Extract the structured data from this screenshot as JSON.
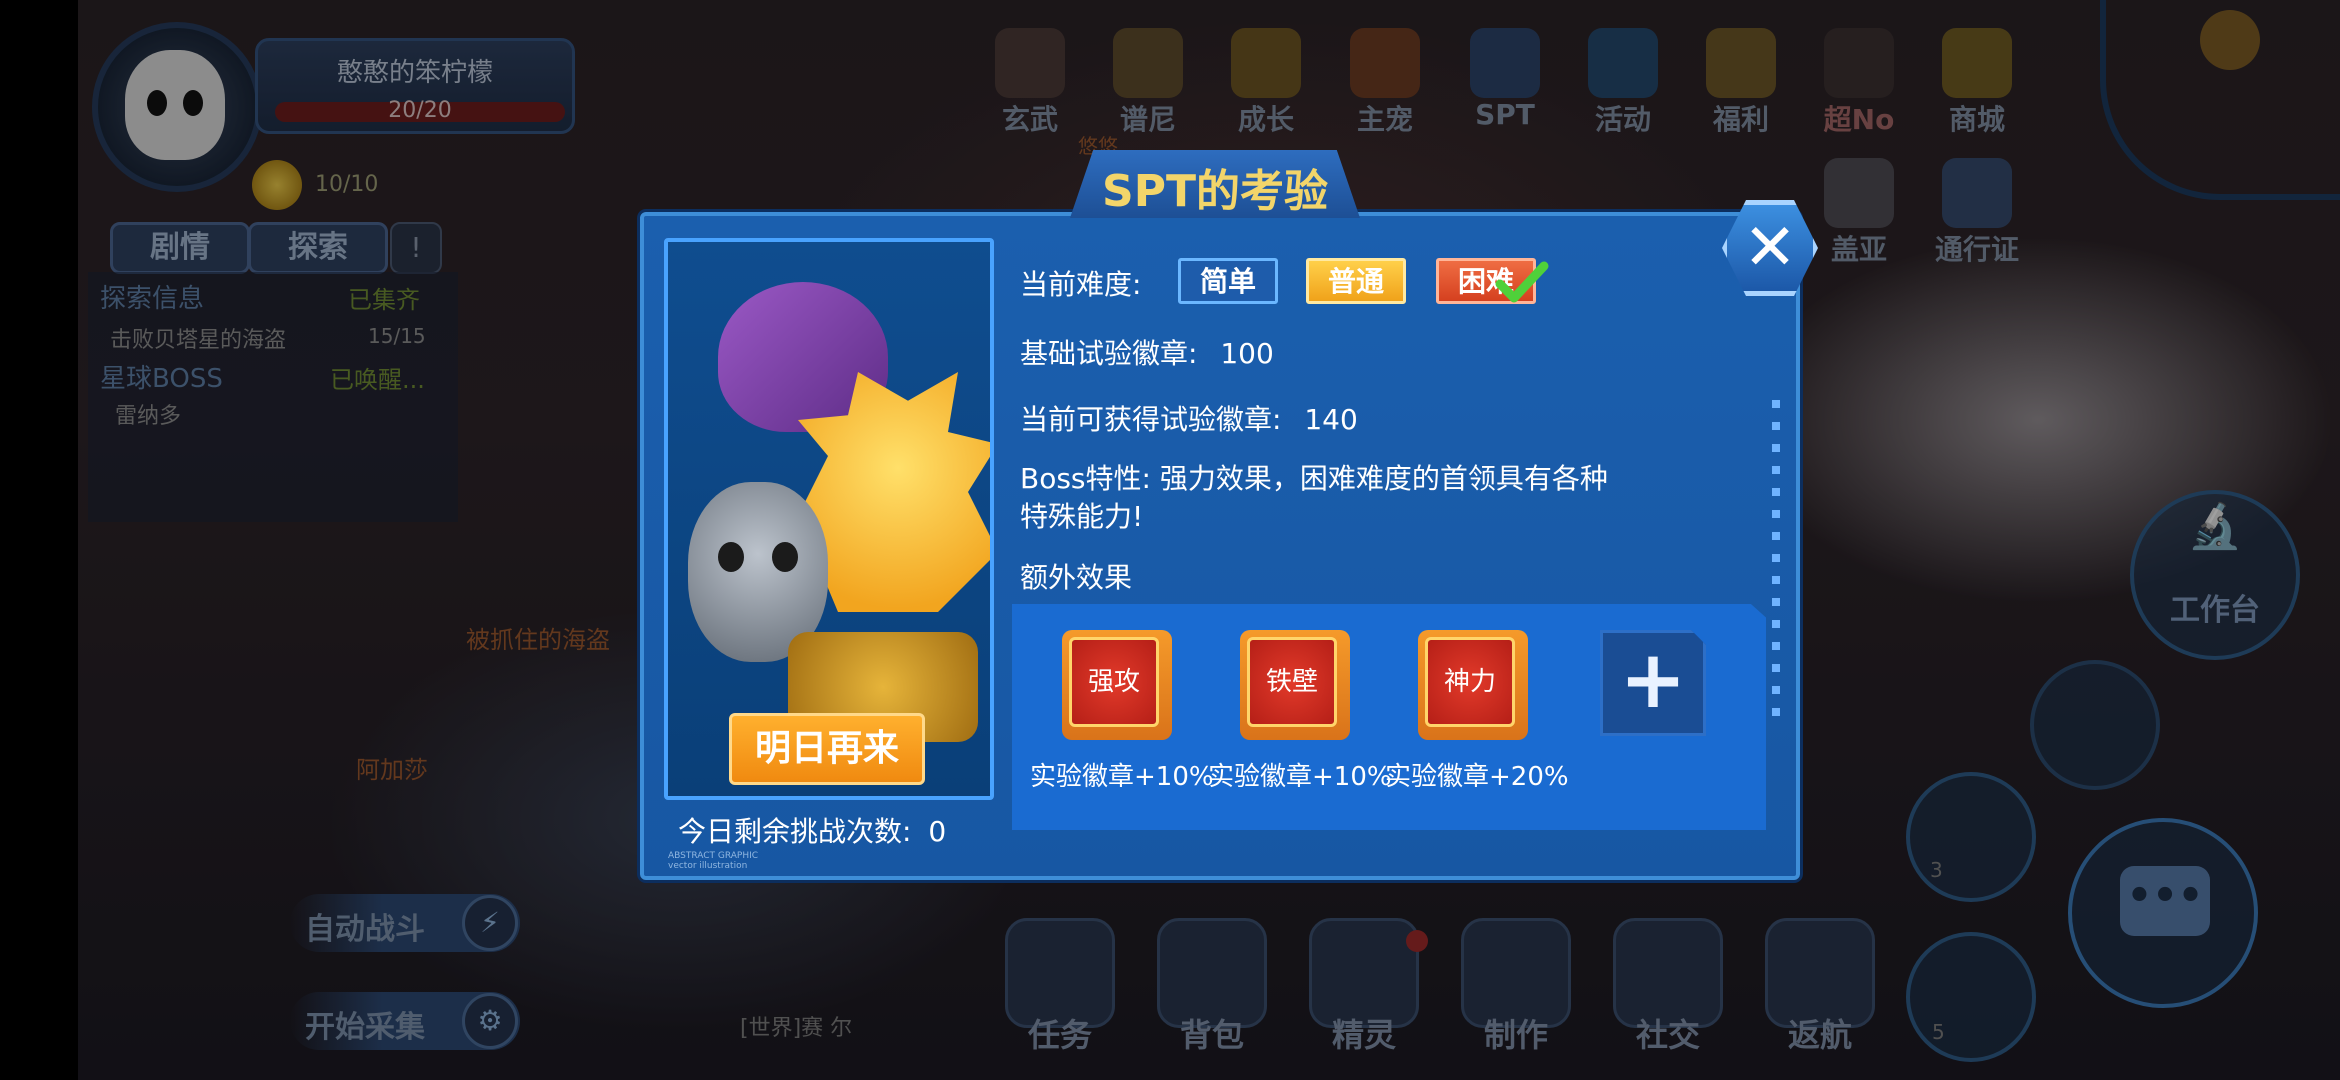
{
  "player": {
    "name": "憨憨的笨柠檬",
    "hp": "20/20",
    "currency": "10/10"
  },
  "left_tabs": {
    "story": "剧情",
    "explore": "探索",
    "info_icon": "info-icon"
  },
  "quests": {
    "explore_title": "探索信息",
    "explore_status": "已集齐",
    "item1": "击败贝塔星的海盗",
    "item1_count": "15/15",
    "boss_title": "星球BOSS",
    "boss_status": "已唤醒...",
    "boss_name": "雷纳多"
  },
  "npc_labels": {
    "captured_pirate": "被抓住的海盗",
    "agasha": "阿加莎",
    "faded_label": "悠悠"
  },
  "side_buttons": {
    "auto_battle": "自动战斗",
    "start_collect": "开始采集"
  },
  "world_chat": "[世界]赛 尔",
  "top_menu": [
    {
      "label": "玄武",
      "icon": "xuanwu-icon"
    },
    {
      "label": "谱尼",
      "icon": "puni-icon"
    },
    {
      "label": "成长",
      "icon": "growth-icon"
    },
    {
      "label": "主宠",
      "icon": "main-pet-icon"
    },
    {
      "label": "SPT",
      "icon": "spt-icon"
    },
    {
      "label": "活动",
      "icon": "event-icon"
    },
    {
      "label": "福利",
      "icon": "gift-icon"
    },
    {
      "label": "超No",
      "icon": "super-no-icon"
    },
    {
      "label": "商城",
      "icon": "diamond-icon"
    }
  ],
  "top_menu_row2": [
    {
      "label": "盖亚",
      "icon": "gaia-icon"
    },
    {
      "label": "通行证",
      "icon": "pass-icon"
    }
  ],
  "right_controls": {
    "workbench": "工作台",
    "slot3": "3",
    "slot5": "5"
  },
  "bottom_menu": [
    {
      "label": "任务",
      "icon": "task-icon"
    },
    {
      "label": "背包",
      "icon": "backpack-icon"
    },
    {
      "label": "精灵",
      "icon": "spirit-icon"
    },
    {
      "label": "制作",
      "icon": "craft-icon"
    },
    {
      "label": "社交",
      "icon": "social-icon"
    },
    {
      "label": "返航",
      "icon": "return-icon"
    }
  ],
  "dialog": {
    "title": "SPT的考验",
    "difficulty_label": "当前难度:",
    "difficulty_options": [
      "简单",
      "普通",
      "困难"
    ],
    "difficulty_selected": "困难",
    "base_badge_label": "基础试验徽章:",
    "base_badge_value": "100",
    "current_badge_label": "当前可获得试验徽章:",
    "current_badge_value": "140",
    "boss_trait_label": "Boss特性:",
    "boss_trait_text": "强力效果，困难难度的首领具有各种特殊能力!",
    "boss_trait_line1": "Boss特性:  强力效果，困难难度的首领具有各种",
    "boss_trait_line2": "特殊能力!",
    "extra_effects_label": "额外效果",
    "buffs": [
      {
        "name": "强攻",
        "caption": "实验徽章+10%"
      },
      {
        "name": "铁壁",
        "caption": "实验徽章+10%"
      },
      {
        "name": "神力",
        "caption": "实验徽章+20%"
      }
    ],
    "add_buff_icon": "plus-icon",
    "come_back_button": "明日再来",
    "remaining_label": "今日剩余挑战次数:",
    "remaining_value": "0",
    "portrait_footnote_line1": "ABSTRACT GRAPHIC",
    "portrait_footnote_line2": "vector illustration"
  },
  "colors": {
    "dialog_bg": "#1b5fae",
    "title_gold": "#f3d56a",
    "normal_gold": "#ffd04a",
    "hard_red": "#d5401f",
    "check_green": "#4fd13a",
    "buff_red": "#e23a2a"
  }
}
